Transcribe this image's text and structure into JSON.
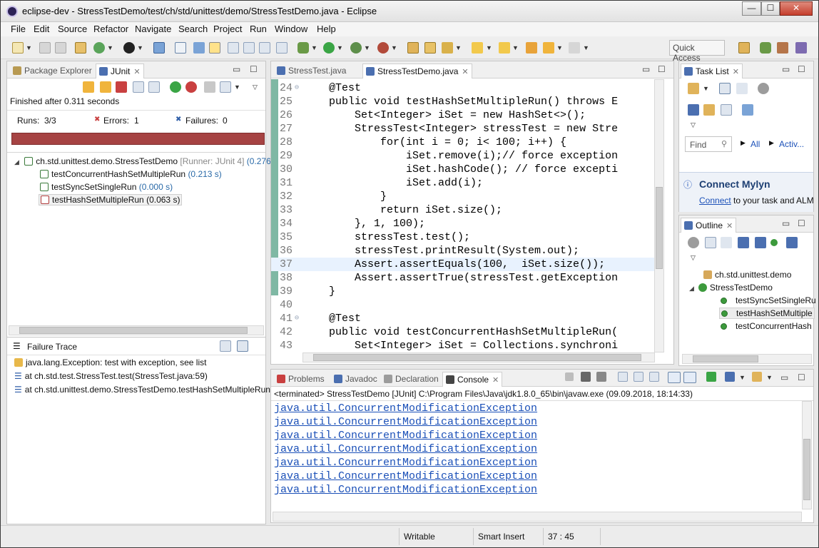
{
  "window": {
    "title": "eclipse-dev - StressTestDemo/test/ch/std/unittest/demo/StressTestDemo.java - Eclipse",
    "min": "—",
    "max": "☐",
    "close": "✕"
  },
  "menu": [
    "File",
    "Edit",
    "Source",
    "Refactor",
    "Navigate",
    "Search",
    "Project",
    "Run",
    "Window",
    "Help"
  ],
  "toolbar": {
    "quick_access": "Quick Access"
  },
  "left_panel": {
    "tabs": [
      "Package Explorer",
      "JUnit"
    ],
    "finished": "Finished after 0.311 seconds",
    "runs_label": "Runs:",
    "runs": "3/3",
    "errors_label": "Errors:",
    "errors": "1",
    "failures_label": "Failures:",
    "failures": "0",
    "bar_color": "#a64343",
    "tree": {
      "suite": "ch.std.unittest.demo.StressTestDemo",
      "suite_runner": "[Runner: JUnit 4]",
      "suite_time": "(0.276",
      "tests": [
        {
          "name": "testConcurrentHashSetMultipleRun",
          "time": "(0.213 s)",
          "status": "pass"
        },
        {
          "name": "testSyncSetSingleRun",
          "time": "(0.000 s)",
          "status": "pass"
        },
        {
          "name": "testHashSetMultipleRun",
          "time": "(0.063 s)",
          "status": "error"
        }
      ]
    },
    "failure_trace_title": "Failure Trace",
    "trace": [
      "java.lang.Exception: test with exception, see list",
      "at ch.std.test.StressTest.test(StressTest.java:59)",
      "at ch.std.unittest.demo.StressTestDemo.testHashSetMultipleRun"
    ]
  },
  "editor": {
    "tabs": [
      "StressTest.java",
      "StressTestDemo.java"
    ],
    "current_line": 37,
    "lines": [
      {
        "n": "24",
        "fold": "⊖",
        "text": "    @Test"
      },
      {
        "n": "25",
        "text": "    public void testHashSetMultipleRun() throws E"
      },
      {
        "n": "26",
        "text": "        Set<Integer> iSet = new HashSet<>();"
      },
      {
        "n": "27",
        "text": "        StressTest<Integer> stressTest = new Stre"
      },
      {
        "n": "28",
        "text": "            for(int i = 0; i< 100; i++) {"
      },
      {
        "n": "29",
        "text": "                iSet.remove(i);// force exception"
      },
      {
        "n": "30",
        "text": "                iSet.hashCode(); // force excepti"
      },
      {
        "n": "31",
        "text": "                iSet.add(i);"
      },
      {
        "n": "32",
        "text": "            }"
      },
      {
        "n": "33",
        "text": "            return iSet.size();"
      },
      {
        "n": "34",
        "text": "        }, 1, 100);"
      },
      {
        "n": "35",
        "text": "        stressTest.test();"
      },
      {
        "n": "36",
        "text": "        stressTest.printResult(System.out);"
      },
      {
        "n": "37",
        "text": "        Assert.assertEquals(100,  iSet.size());"
      },
      {
        "n": "38",
        "text": "        Assert.assertTrue(stressTest.getException"
      },
      {
        "n": "39",
        "text": "    }"
      },
      {
        "n": "40",
        "text": ""
      },
      {
        "n": "41",
        "fold": "⊖",
        "text": "    @Test"
      },
      {
        "n": "42",
        "text": "    public void testConcurrentHashSetMultipleRun("
      },
      {
        "n": "43",
        "text": "        Set<Integer> iSet = Collections.synchroni"
      }
    ]
  },
  "task_list": {
    "tab": "Task List",
    "find_placeholder": "Find",
    "all": "All",
    "activ": "Activ...",
    "mylyn_title": "Connect Mylyn",
    "mylyn_link": "Connect",
    "mylyn_text": "to your task and ALM"
  },
  "outline": {
    "tab": "Outline",
    "package": "ch.std.unittest.demo",
    "class": "StressTestDemo",
    "methods": [
      "testSyncSetSingleRu",
      "testHashSetMultiple",
      "testConcurrentHash"
    ]
  },
  "console": {
    "tabs": [
      "Problems",
      "Javadoc",
      "Declaration",
      "Console"
    ],
    "header": "<terminated> StressTestDemo [JUnit] C:\\Program Files\\Java\\jdk1.8.0_65\\bin\\javaw.exe (09.09.2018, 18:14:33)",
    "lines": [
      "java.util.ConcurrentModificationException",
      "java.util.ConcurrentModificationException",
      "java.util.ConcurrentModificationException",
      "java.util.ConcurrentModificationException",
      "java.util.ConcurrentModificationException",
      "java.util.ConcurrentModificationException",
      "java.util.ConcurrentModificationException"
    ]
  },
  "status_bar": {
    "writable": "Writable",
    "insert_mode": "Smart Insert",
    "position": "37 : 45"
  }
}
